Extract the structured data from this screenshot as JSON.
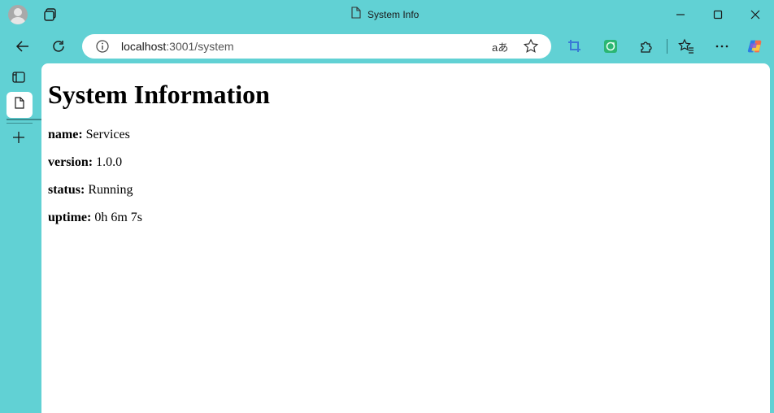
{
  "window": {
    "title": "System Info"
  },
  "toolbar": {
    "url_host": "localhost",
    "url_path": ":3001/system",
    "read_aloud_label": "aあ"
  },
  "page": {
    "heading": "System Information",
    "fields": [
      {
        "label": "name:",
        "value": "Services"
      },
      {
        "label": "version:",
        "value": "1.0.0"
      },
      {
        "label": "status:",
        "value": "Running"
      },
      {
        "label": "uptime:",
        "value": "0h 6m 7s"
      }
    ]
  },
  "colors": {
    "frame": "#61d1d4",
    "content_bg": "#ffffff",
    "accent_blue": "#3a7bd5",
    "accent_green": "#2bb673"
  },
  "icons": [
    "profile-avatar-icon",
    "workspaces-icon",
    "page-icon",
    "minimize-icon",
    "maximize-icon",
    "close-icon",
    "back-icon",
    "refresh-icon",
    "info-icon",
    "read-aloud-icon",
    "favorite-star-icon",
    "screen-capture-icon",
    "extension-green-icon",
    "extensions-icon",
    "favorites-icon",
    "more-icon",
    "copilot-icon",
    "tab-actions-icon",
    "tab-page-icon",
    "new-tab-icon"
  ]
}
